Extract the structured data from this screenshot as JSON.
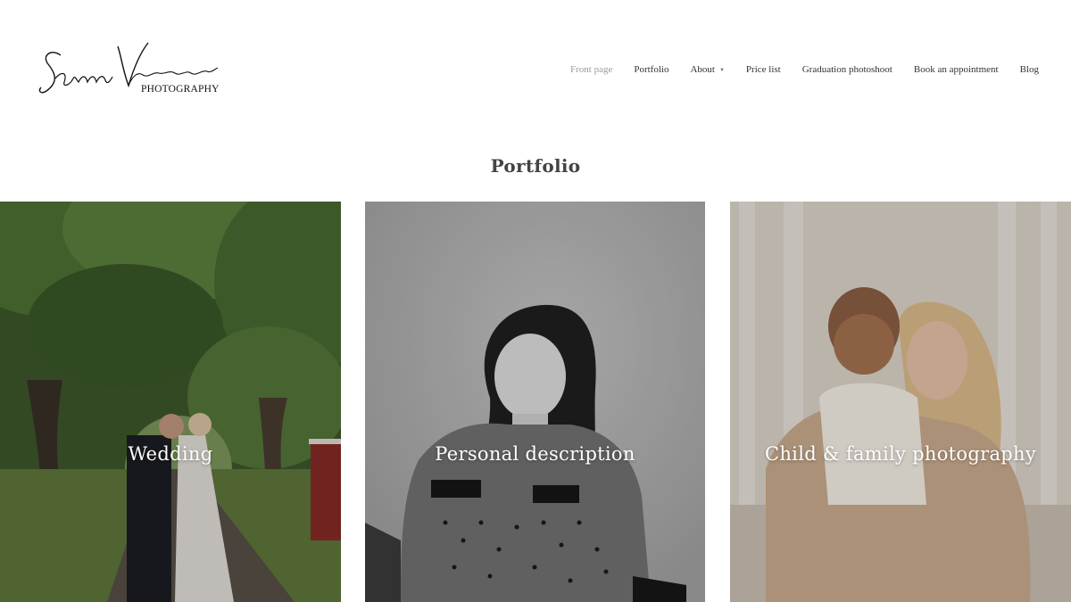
{
  "brand": {
    "script_name": "Sanna Vihervuori",
    "subtitle": "PHOTOGRAPHY"
  },
  "nav": {
    "items": [
      {
        "label": "Front page",
        "active": true
      },
      {
        "label": "Portfolio",
        "active": false
      },
      {
        "label": "About",
        "active": false,
        "has_dropdown": true
      },
      {
        "label": "Price list",
        "active": false
      },
      {
        "label": "Graduation photoshoot",
        "active": false
      },
      {
        "label": "Book an appointment",
        "active": false
      },
      {
        "label": "Blog",
        "active": false
      }
    ]
  },
  "section": {
    "title": "Portfolio"
  },
  "tiles": [
    {
      "label": "Wedding"
    },
    {
      "label": "Personal description"
    },
    {
      "label": "Child & family photography"
    }
  ],
  "colors": {
    "nav_text": "#333333",
    "nav_active": "#9a9a9a",
    "tile_text": "#ffffff"
  }
}
